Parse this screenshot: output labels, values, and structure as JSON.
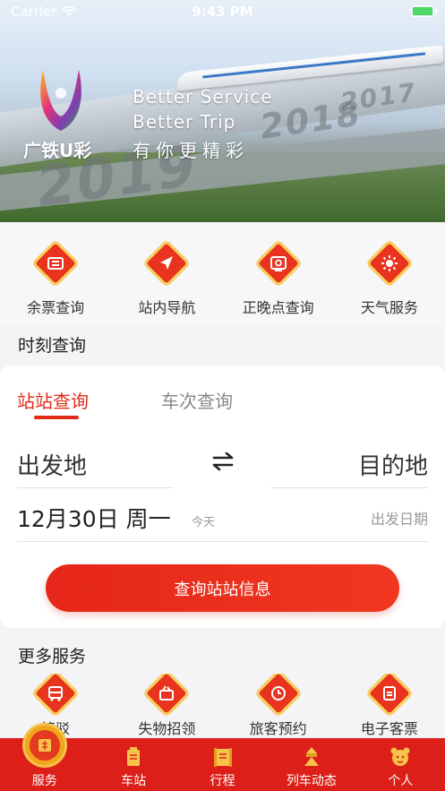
{
  "status_bar": {
    "carrier": "Carrier",
    "time": "9:43 PM"
  },
  "banner": {
    "logo_text": "广铁U彩",
    "slogan_line1": "Better Service",
    "slogan_line2": "Better Trip",
    "slogan_line3": "有你更精彩",
    "years": [
      "2019",
      "2018",
      "2017"
    ]
  },
  "quick_services": [
    {
      "label": "余票查询",
      "icon": "ticket-icon"
    },
    {
      "label": "站内导航",
      "icon": "navigation-icon"
    },
    {
      "label": "正晚点查询",
      "icon": "delay-query-icon"
    },
    {
      "label": "天气服务",
      "icon": "weather-icon"
    }
  ],
  "schedule": {
    "title": "时刻查询",
    "tabs": [
      "站站查询",
      "车次查询"
    ],
    "from": "出发地",
    "to": "目的地",
    "date": "12月30日 周一",
    "today": "今天",
    "date_label": "出发日期",
    "search_button": "查询站站信息"
  },
  "more_services": {
    "title": "更多服务",
    "items": [
      {
        "label": "接驳",
        "icon": "bus-icon"
      },
      {
        "label": "失物招领",
        "icon": "lost-found-icon"
      },
      {
        "label": "旅客预约",
        "icon": "clock-icon"
      },
      {
        "label": "电子客票",
        "icon": "e-ticket-icon"
      }
    ]
  },
  "tab_bar": [
    {
      "label": "服务",
      "icon": "service-icon",
      "active": true
    },
    {
      "label": "车站",
      "icon": "station-icon"
    },
    {
      "label": "行程",
      "icon": "itinerary-icon"
    },
    {
      "label": "列车动态",
      "icon": "train-status-icon"
    },
    {
      "label": "个人",
      "icon": "profile-icon"
    }
  ],
  "colors": {
    "primary": "#dd1f19",
    "accent_gold": "#f6d15a",
    "background": "#f4f4f6"
  }
}
